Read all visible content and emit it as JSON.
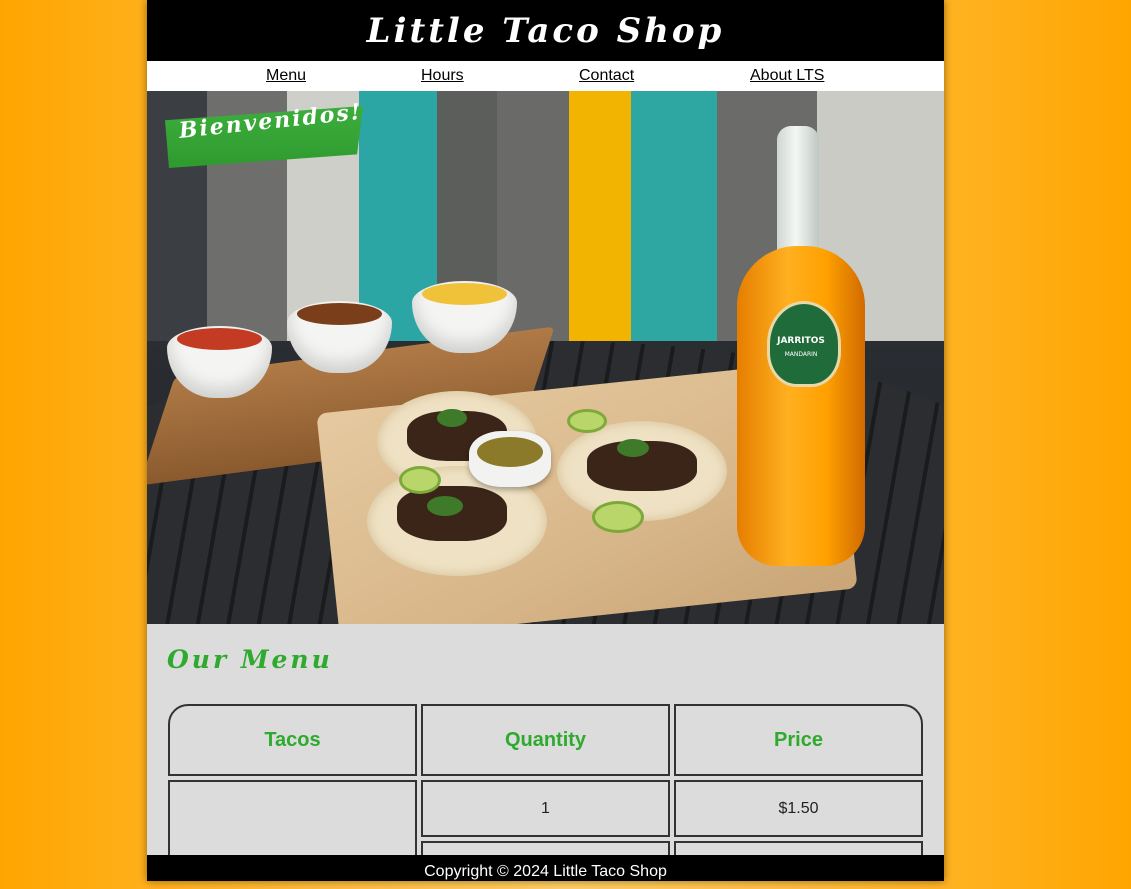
{
  "site": {
    "title": "Little Taco Shop"
  },
  "nav": {
    "items": [
      {
        "label": "Menu"
      },
      {
        "label": "Hours"
      },
      {
        "label": "Contact"
      },
      {
        "label": "About LTS"
      }
    ]
  },
  "hero": {
    "banner": "Bienvenidos!",
    "bottle_label": "JARRITOS",
    "bottle_flavor": "MANDARIN"
  },
  "menu": {
    "title": "Our Menu",
    "headers": [
      "Tacos",
      "Quantity",
      "Price"
    ],
    "rows": [
      {
        "item": "",
        "quantity": "1",
        "price": "$1.50"
      },
      {
        "quantity": "",
        "price": ""
      }
    ]
  },
  "footer": {
    "text": "Copyright © 2024 Little Taco Shop"
  },
  "colors": {
    "accent_green": "#2eaa2e",
    "background_orange": "#ffa500",
    "header_black": "#000000"
  }
}
